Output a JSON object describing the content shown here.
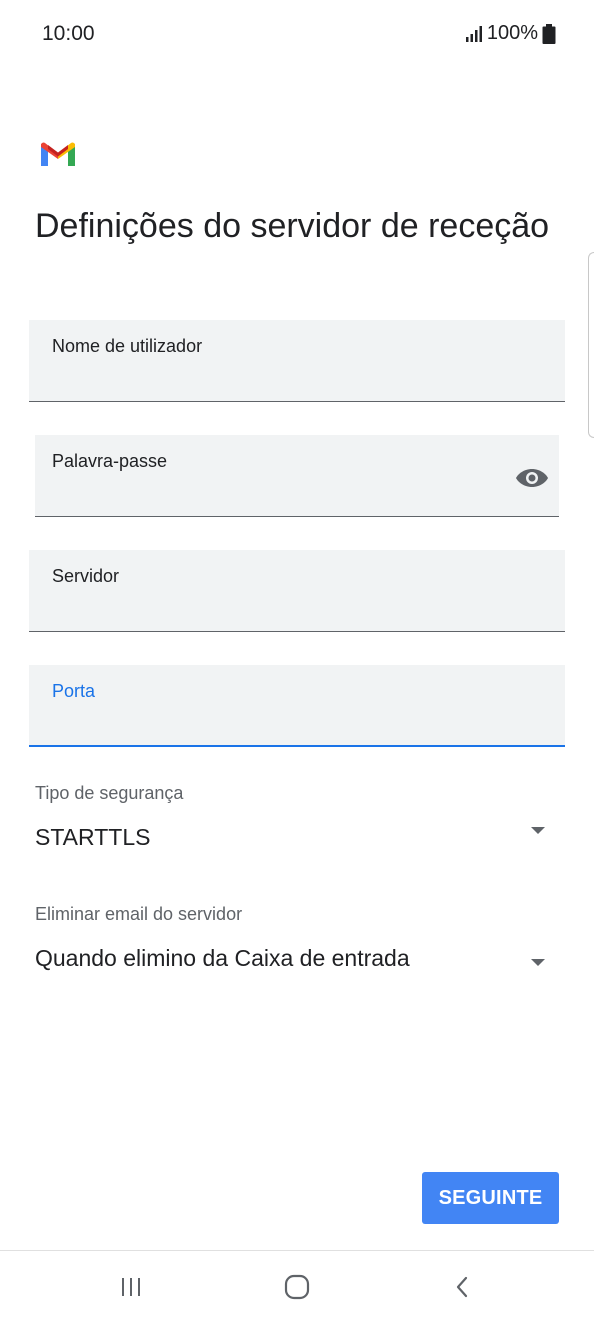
{
  "status_bar": {
    "time": "10:00",
    "battery": "100%"
  },
  "app": {
    "logo": "gmail-logo"
  },
  "page": {
    "title": "Definições do servidor de receção"
  },
  "fields": {
    "username": {
      "label": "Nome de utilizador",
      "value": ""
    },
    "password": {
      "label": "Palavra-passe",
      "value": ""
    },
    "server": {
      "label": "Servidor",
      "value": ""
    },
    "port": {
      "label": "Porta",
      "value": ""
    }
  },
  "security": {
    "label": "Tipo de segurança",
    "value": "STARTTLS"
  },
  "delete_email": {
    "label": "Eliminar email do servidor",
    "value": "Quando elimino da Caixa de entrada"
  },
  "actions": {
    "next_label": "SEGUINTE"
  },
  "colors": {
    "accent": "#1a73e8",
    "button": "#4285f4",
    "field_bg": "#f1f3f4"
  },
  "nav": {
    "icons": [
      "recents-icon",
      "home-icon",
      "back-icon"
    ]
  }
}
